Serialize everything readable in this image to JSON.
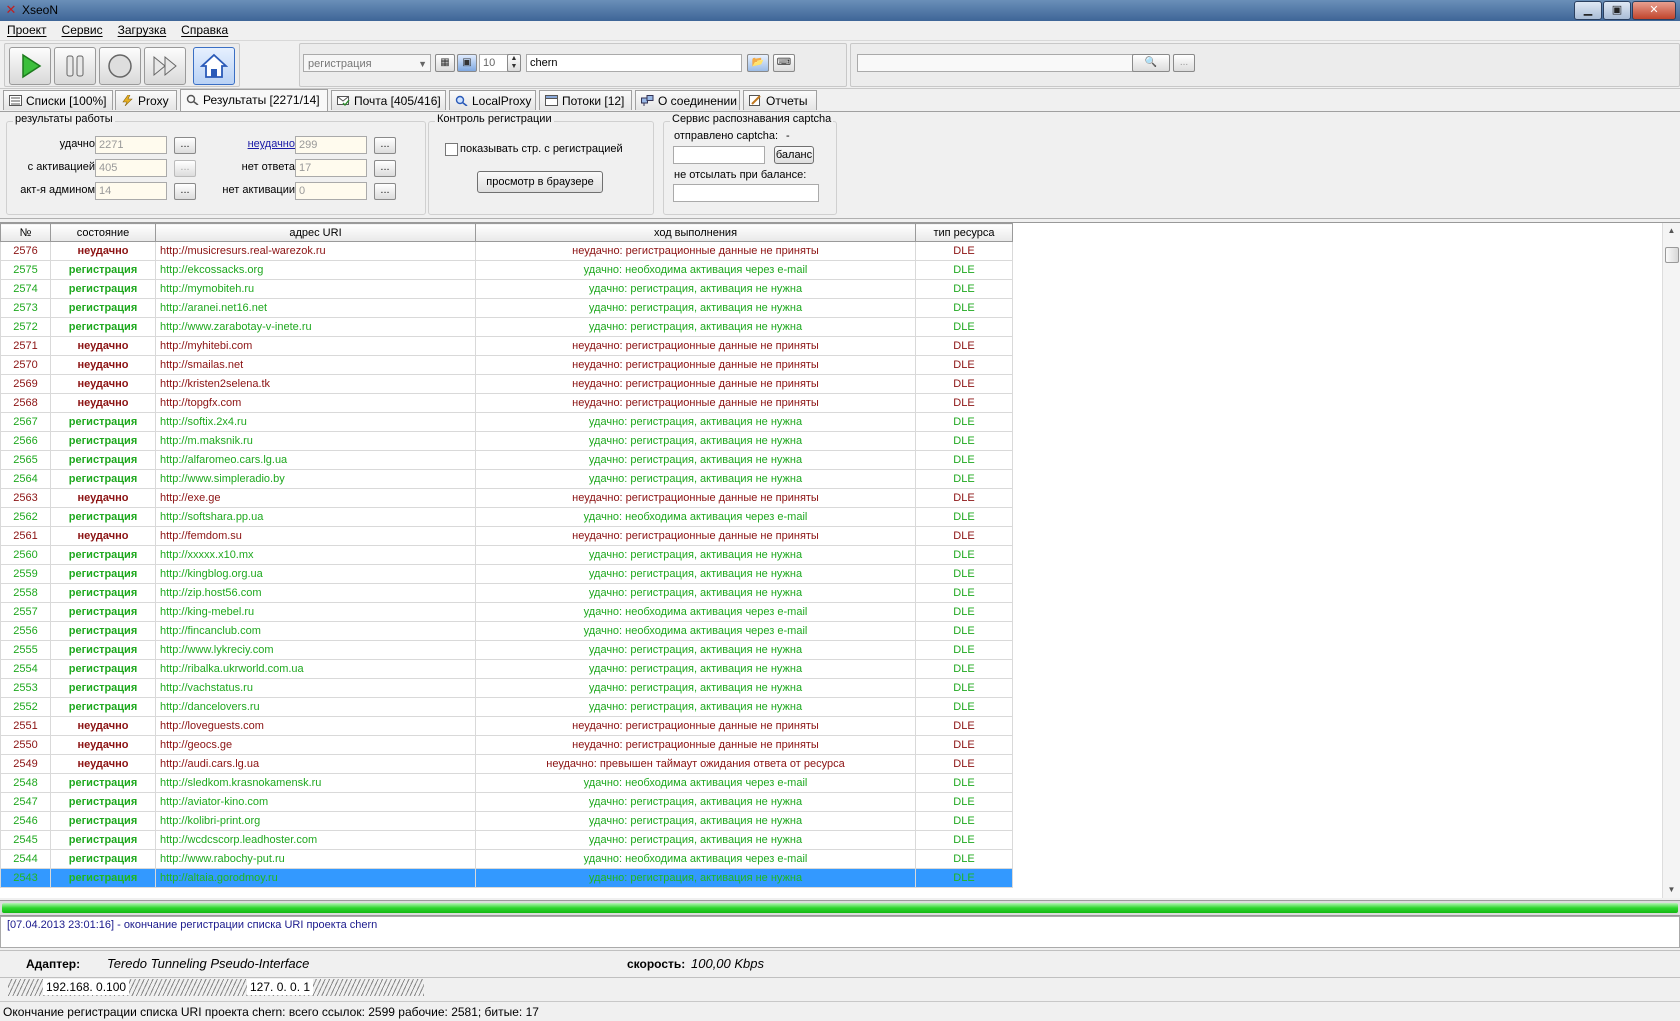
{
  "window": {
    "title": "XseoN",
    "min": "▁",
    "max": "▣",
    "close": "✕"
  },
  "menu": [
    "Проект",
    "Сервис",
    "Загрузка",
    "Справка"
  ],
  "toolbar": {
    "mode": "регистрация",
    "threads": "10",
    "project": "chern",
    "search_value": "",
    "more_label": "..."
  },
  "tabs": [
    {
      "label": "Списки [100%]"
    },
    {
      "label": "Proxy"
    },
    {
      "label": "Результаты [2271/14]",
      "active": true
    },
    {
      "label": "Почта [405/416]"
    },
    {
      "label": "LocalProxy"
    },
    {
      "label": "Потоки [12]"
    },
    {
      "label": "О соединении"
    },
    {
      "label": "Отчеты"
    }
  ],
  "results": {
    "title": "результаты работы",
    "success_label": "удачно",
    "success": "2271",
    "activation_label": "с активацией",
    "activation": "405",
    "admin_label": "акт-я админом",
    "admin": "14",
    "fail_label": "неудачно",
    "fail": "299",
    "noanswer_label": "нет ответа",
    "noanswer": "17",
    "noactivation_label": "нет активации",
    "noactivation": "0",
    "dots": "..."
  },
  "control": {
    "title": "Контроль регистрации",
    "show_label": "показывать стр. с регистрацией",
    "browser_button": "просмотр в браузере"
  },
  "captcha": {
    "title": "Сервис распознавания captcha",
    "sent_label": "отправлено captcha:",
    "sent_value": "-",
    "balance_button": "баланс",
    "no_send_label": "не отсылать при балансе:",
    "balance_value": ""
  },
  "grid": {
    "headers": [
      "№",
      "состояние",
      "адрес URI",
      "ход выполнения",
      "тип ресурса"
    ],
    "rows": [
      {
        "n": "2576",
        "s": "неудачно",
        "u": "http://musicresurs.real-warezok.ru",
        "p": "неудачно: регистрационные данные не приняты",
        "t": "DLE",
        "ok": false
      },
      {
        "n": "2575",
        "s": "регистрация",
        "u": "http://ekcossacks.org",
        "p": "удачно: необходима активация через e-mail",
        "t": "DLE",
        "ok": true
      },
      {
        "n": "2574",
        "s": "регистрация",
        "u": "http://mymobiteh.ru",
        "p": "удачно: регистрация, активация не нужна",
        "t": "DLE",
        "ok": true
      },
      {
        "n": "2573",
        "s": "регистрация",
        "u": "http://aranei.net16.net",
        "p": "удачно: регистрация, активация не нужна",
        "t": "DLE",
        "ok": true
      },
      {
        "n": "2572",
        "s": "регистрация",
        "u": "http://www.zarabotay-v-inete.ru",
        "p": "удачно: регистрация, активация не нужна",
        "t": "DLE",
        "ok": true
      },
      {
        "n": "2571",
        "s": "неудачно",
        "u": "http://myhitebi.com",
        "p": "неудачно: регистрационные данные не приняты",
        "t": "DLE",
        "ok": false
      },
      {
        "n": "2570",
        "s": "неудачно",
        "u": "http://smailas.net",
        "p": "неудачно: регистрационные данные не приняты",
        "t": "DLE",
        "ok": false
      },
      {
        "n": "2569",
        "s": "неудачно",
        "u": "http://kristen2selena.tk",
        "p": "неудачно: регистрационные данные не приняты",
        "t": "DLE",
        "ok": false
      },
      {
        "n": "2568",
        "s": "неудачно",
        "u": "http://topgfx.com",
        "p": "неудачно: регистрационные данные не приняты",
        "t": "DLE",
        "ok": false
      },
      {
        "n": "2567",
        "s": "регистрация",
        "u": "http://softix.2x4.ru",
        "p": "удачно: регистрация, активация не нужна",
        "t": "DLE",
        "ok": true
      },
      {
        "n": "2566",
        "s": "регистрация",
        "u": "http://m.maksnik.ru",
        "p": "удачно: регистрация, активация не нужна",
        "t": "DLE",
        "ok": true
      },
      {
        "n": "2565",
        "s": "регистрация",
        "u": "http://alfaromeo.cars.lg.ua",
        "p": "удачно: регистрация, активация не нужна",
        "t": "DLE",
        "ok": true
      },
      {
        "n": "2564",
        "s": "регистрация",
        "u": "http://www.simpleradio.by",
        "p": "удачно: регистрация, активация не нужна",
        "t": "DLE",
        "ok": true
      },
      {
        "n": "2563",
        "s": "неудачно",
        "u": "http://exe.ge",
        "p": "неудачно: регистрационные данные не приняты",
        "t": "DLE",
        "ok": false
      },
      {
        "n": "2562",
        "s": "регистрация",
        "u": "http://softshara.pp.ua",
        "p": "удачно: необходима активация через e-mail",
        "t": "DLE",
        "ok": true
      },
      {
        "n": "2561",
        "s": "неудачно",
        "u": "http://femdom.su",
        "p": "неудачно: регистрационные данные не приняты",
        "t": "DLE",
        "ok": false
      },
      {
        "n": "2560",
        "s": "регистрация",
        "u": "http://xxxxx.x10.mx",
        "p": "удачно: регистрация, активация не нужна",
        "t": "DLE",
        "ok": true
      },
      {
        "n": "2559",
        "s": "регистрация",
        "u": "http://kingblog.org.ua",
        "p": "удачно: регистрация, активация не нужна",
        "t": "DLE",
        "ok": true
      },
      {
        "n": "2558",
        "s": "регистрация",
        "u": "http://zip.host56.com",
        "p": "удачно: регистрация, активация не нужна",
        "t": "DLE",
        "ok": true
      },
      {
        "n": "2557",
        "s": "регистрация",
        "u": "http://king-mebel.ru",
        "p": "удачно: необходима активация через e-mail",
        "t": "DLE",
        "ok": true
      },
      {
        "n": "2556",
        "s": "регистрация",
        "u": "http://fincanclub.com",
        "p": "удачно: необходима активация через e-mail",
        "t": "DLE",
        "ok": true
      },
      {
        "n": "2555",
        "s": "регистрация",
        "u": "http://www.lykreciy.com",
        "p": "удачно: регистрация, активация не нужна",
        "t": "DLE",
        "ok": true
      },
      {
        "n": "2554",
        "s": "регистрация",
        "u": "http://ribalka.ukrworld.com.ua",
        "p": "удачно: регистрация, активация не нужна",
        "t": "DLE",
        "ok": true
      },
      {
        "n": "2553",
        "s": "регистрация",
        "u": "http://vachstatus.ru",
        "p": "удачно: регистрация, активация не нужна",
        "t": "DLE",
        "ok": true
      },
      {
        "n": "2552",
        "s": "регистрация",
        "u": "http://dancelovers.ru",
        "p": "удачно: регистрация, активация не нужна",
        "t": "DLE",
        "ok": true
      },
      {
        "n": "2551",
        "s": "неудачно",
        "u": "http://loveguests.com",
        "p": "неудачно: регистрационные данные не приняты",
        "t": "DLE",
        "ok": false
      },
      {
        "n": "2550",
        "s": "неудачно",
        "u": "http://geocs.ge",
        "p": "неудачно: регистрационные данные не приняты",
        "t": "DLE",
        "ok": false
      },
      {
        "n": "2549",
        "s": "неудачно",
        "u": "http://audi.cars.lg.ua",
        "p": "неудачно: превышен таймаут ожидания ответа от ресурса",
        "t": "DLE",
        "ok": false
      },
      {
        "n": "2548",
        "s": "регистрация",
        "u": "http://sledkom.krasnokamensk.ru",
        "p": "удачно: необходима активация через e-mail",
        "t": "DLE",
        "ok": true
      },
      {
        "n": "2547",
        "s": "регистрация",
        "u": "http://aviator-kino.com",
        "p": "удачно: регистрация, активация не нужна",
        "t": "DLE",
        "ok": true
      },
      {
        "n": "2546",
        "s": "регистрация",
        "u": "http://kolibri-print.org",
        "p": "удачно: регистрация, активация не нужна",
        "t": "DLE",
        "ok": true
      },
      {
        "n": "2545",
        "s": "регистрация",
        "u": "http://wcdcscorp.leadhoster.com",
        "p": "удачно: регистрация, активация не нужна",
        "t": "DLE",
        "ok": true
      },
      {
        "n": "2544",
        "s": "регистрация",
        "u": "http://www.rabochy-put.ru",
        "p": "удачно: необходима активация через e-mail",
        "t": "DLE",
        "ok": true
      },
      {
        "n": "2543",
        "s": "регистрация",
        "u": "http://altaia.gorodmoy.ru",
        "p": "удачно: регистрация, активация не нужна",
        "t": "DLE",
        "ok": true,
        "sel": true
      }
    ]
  },
  "progress": {
    "fraction": 1.0
  },
  "log": "[07.04.2013 23:01:16] - окончание регистрации списка URI проекта chern",
  "adapter": {
    "label": "Адаптер:",
    "name": "Teredo Tunneling Pseudo-Interface",
    "speed_label": "скорость:",
    "speed": "100,00 Kbps"
  },
  "ip": {
    "local": "192.168.  0.100",
    "loop": "127.  0.  0.  1"
  },
  "status": "Окончание регистрации списка URI проекта chern: всего ссылок: 2599 рабочие: 2581; битые: 17",
  "colors": {
    "success": "#1fa81f",
    "fail": "#8b1212",
    "selection": "#3399ff",
    "link": "#1a1aa6"
  }
}
